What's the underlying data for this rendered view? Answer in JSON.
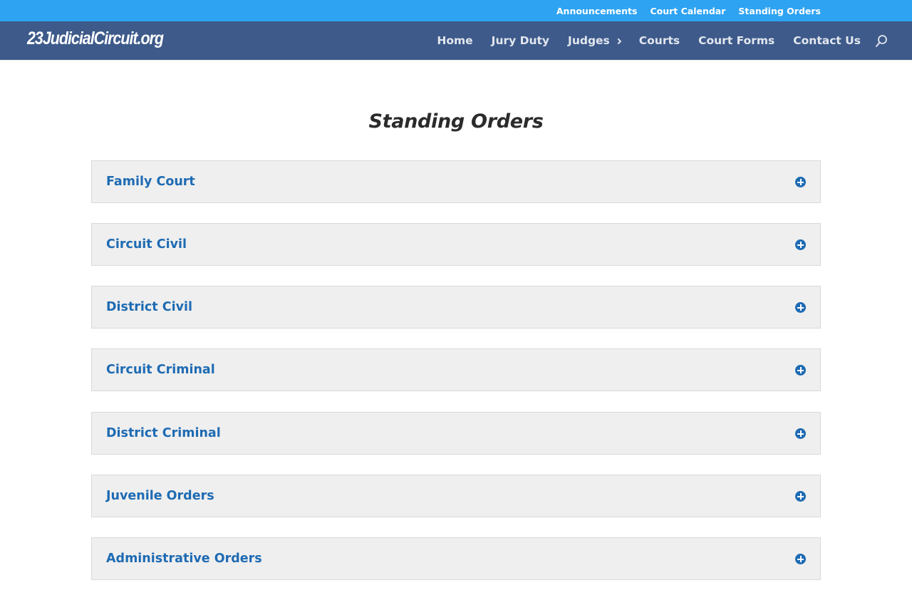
{
  "top_bar": {
    "links": [
      "Announcements",
      "Court Calendar",
      "Standing Orders"
    ],
    "color": "#2ea3f2"
  },
  "header": {
    "logo": "23JudicialCircuit.org",
    "nav": [
      "Home",
      "Jury Duty",
      "Judges",
      "Courts",
      "Court Forms",
      "Contact Us"
    ],
    "color": "#3d5a8a"
  },
  "page": {
    "title": "Standing Orders"
  },
  "accordion": {
    "items": [
      "Family Court",
      "Circuit Civil",
      "District Civil",
      "Circuit Criminal",
      "District Criminal",
      "Juvenile Orders",
      "Administrative Orders"
    ],
    "accent": "#1e6bb3"
  }
}
